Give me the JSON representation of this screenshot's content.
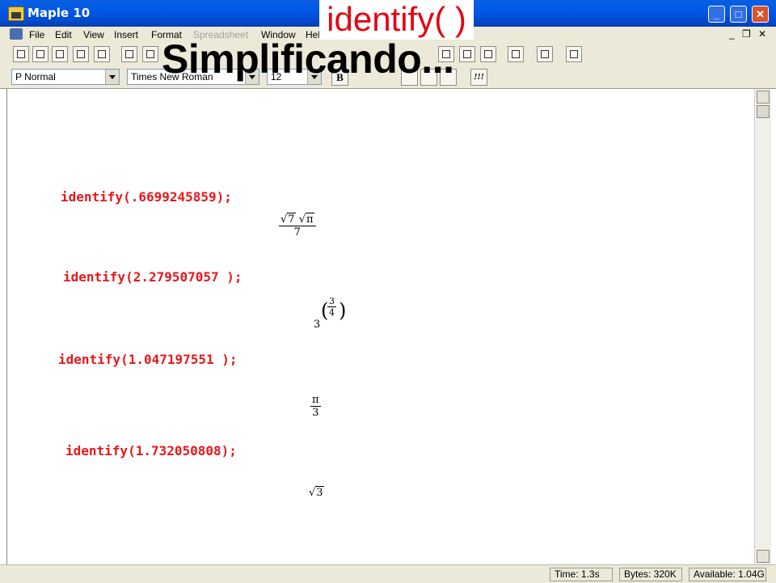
{
  "window": {
    "title": "Maple 10",
    "minimize": "_",
    "maximize": "□",
    "close": "✕"
  },
  "menu": [
    {
      "label": "File",
      "disabled": false
    },
    {
      "label": "Edit",
      "disabled": false
    },
    {
      "label": "View",
      "disabled": false
    },
    {
      "label": "Insert",
      "disabled": false
    },
    {
      "label": "Format",
      "disabled": false
    },
    {
      "label": "Spreadsheet",
      "disabled": true
    },
    {
      "label": "Window",
      "disabled": false
    },
    {
      "label": "Hel",
      "disabled": false
    }
  ],
  "mdi": {
    "minimize": "_",
    "restore": "❐",
    "close": "✕"
  },
  "format_bar": {
    "style": "P Normal",
    "font": "Times New Roman",
    "size": "12",
    "bold": "B",
    "exec": "!!!"
  },
  "overlay": {
    "title": "identify( )",
    "subtitle": "Simplificando..."
  },
  "worksheet": {
    "commands": [
      "identify(.6699245859);",
      "identify(2.279507057 );",
      "identify(1.047197551 );",
      "identify(1.732050808);"
    ],
    "results": {
      "r1": {
        "n1": "7",
        "n2": "π",
        "den": "7"
      },
      "r2": {
        "base": "3",
        "en": "3",
        "ed": "4"
      },
      "r3": {
        "num": "π",
        "den": "3"
      },
      "r4": {
        "rad": "3"
      }
    }
  },
  "status": {
    "time": "Time:  1.3s",
    "bytes": "Bytes:  320K",
    "available": "Available:  1.04G"
  },
  "colors": {
    "command": "#e8181b",
    "overlay_title": "#e30613",
    "titlebar": "#0058e6"
  }
}
